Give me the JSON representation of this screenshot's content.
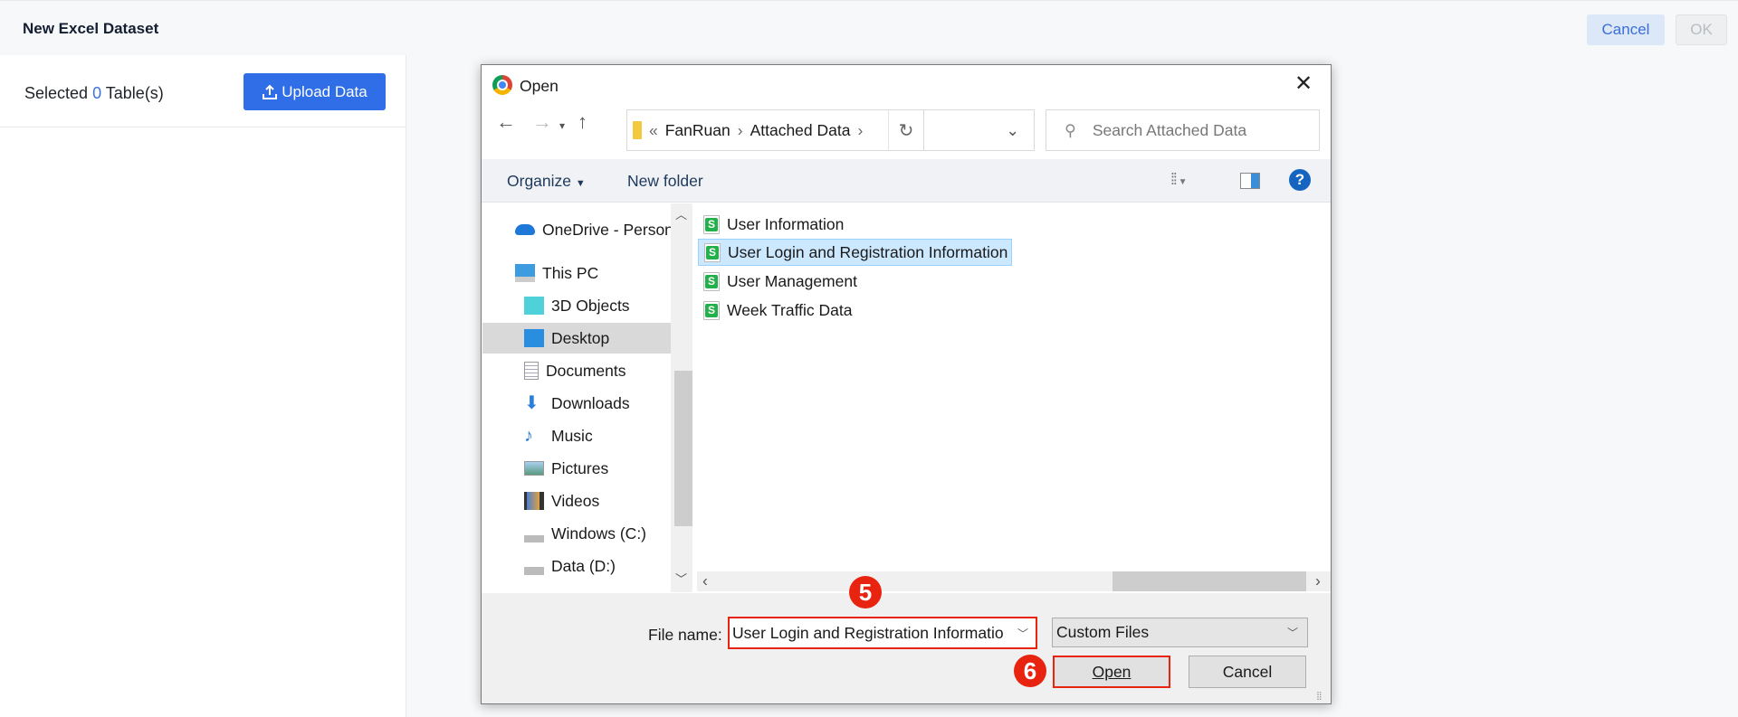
{
  "header": {
    "title": "New Excel Dataset",
    "cancel": "Cancel",
    "ok": "OK"
  },
  "left": {
    "selected_prefix": "Selected",
    "selected_count": "0",
    "selected_suffix": "Table(s)",
    "upload": "Upload Data"
  },
  "dialog": {
    "title": "Open",
    "breadcrumb": {
      "overflow": "«",
      "items": [
        "FanRuan",
        "Attached Data"
      ]
    },
    "search_placeholder": "Search Attached Data",
    "toolbar": {
      "organize": "Organize",
      "new_folder": "New folder"
    },
    "nav": [
      {
        "label": "OneDrive - Person",
        "icon": "onedrive-icon"
      },
      {
        "label": "This PC",
        "icon": "pc-icon"
      },
      {
        "label": "3D Objects",
        "icon": "3d-objects-icon"
      },
      {
        "label": "Desktop",
        "icon": "desktop-icon",
        "selected": true
      },
      {
        "label": "Documents",
        "icon": "documents-icon"
      },
      {
        "label": "Downloads",
        "icon": "downloads-icon"
      },
      {
        "label": "Music",
        "icon": "music-icon"
      },
      {
        "label": "Pictures",
        "icon": "pictures-icon"
      },
      {
        "label": "Videos",
        "icon": "videos-icon"
      },
      {
        "label": "Windows (C:)",
        "icon": "drive-c-icon"
      },
      {
        "label": "Data (D:)",
        "icon": "drive-d-icon"
      }
    ],
    "files": [
      {
        "name": "User Information"
      },
      {
        "name": "User Login and Registration Information",
        "selected": true
      },
      {
        "name": "User Management"
      },
      {
        "name": "Week Traffic Data"
      }
    ],
    "file_name_label": "File name:",
    "file_name_value": "User Login and Registration Informatio",
    "file_type": "Custom Files",
    "open": "Open",
    "cancel": "Cancel"
  },
  "annotations": {
    "step5": "5",
    "step6": "6",
    "color": "#e8230f"
  }
}
